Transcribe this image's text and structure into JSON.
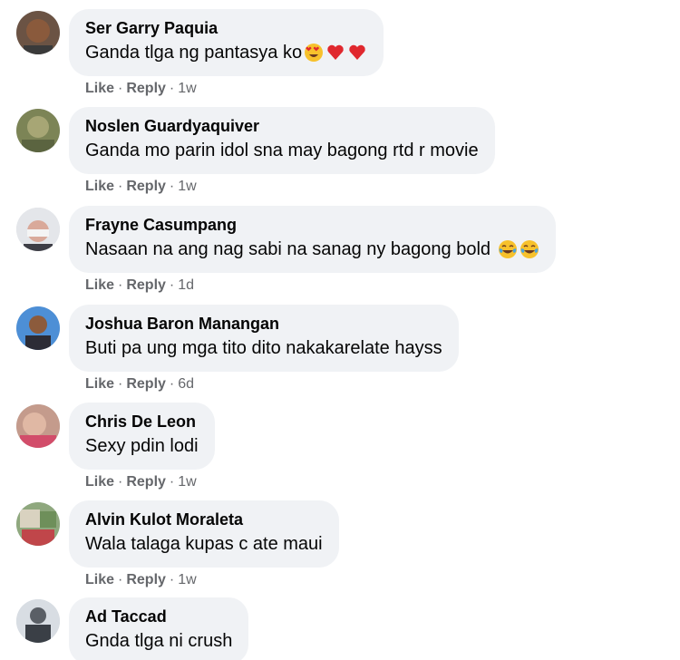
{
  "comments": [
    {
      "author": "Ser Garry Paquia",
      "text": "Ganda tlga ng pantasya ko",
      "emojis": [
        "heart-eyes-emoji",
        "red-heart-emoji",
        "red-heart-emoji"
      ],
      "like_label": "Like",
      "reply_label": "Reply",
      "time": "1w"
    },
    {
      "author": "Noslen Guardyaquiver",
      "text": "Ganda mo parin idol sna may bagong rtd r movie",
      "emojis": [],
      "like_label": "Like",
      "reply_label": "Reply",
      "time": "1w"
    },
    {
      "author": "Frayne Casumpang",
      "text": "Nasaan na ang nag sabi na sanag ny bagong bold",
      "emojis": [
        "tears-of-joy-emoji",
        "tears-of-joy-emoji"
      ],
      "like_label": "Like",
      "reply_label": "Reply",
      "time": "1d"
    },
    {
      "author": "Joshua Baron Manangan",
      "text": "Buti pa ung mga tito dito nakakarelate hayss",
      "emojis": [],
      "like_label": "Like",
      "reply_label": "Reply",
      "time": "6d"
    },
    {
      "author": "Chris De Leon",
      "text": "Sexy pdin lodi",
      "emojis": [],
      "like_label": "Like",
      "reply_label": "Reply",
      "time": "1w"
    },
    {
      "author": "Alvin Kulot Moraleta",
      "text": "Wala talaga kupas c ate maui",
      "emojis": [],
      "like_label": "Like",
      "reply_label": "Reply",
      "time": "1w"
    },
    {
      "author": "Ad Taccad",
      "text": "Gnda tlga ni crush",
      "emojis": [],
      "like_label": "",
      "reply_label": "",
      "time": ""
    }
  ],
  "separator": "·"
}
